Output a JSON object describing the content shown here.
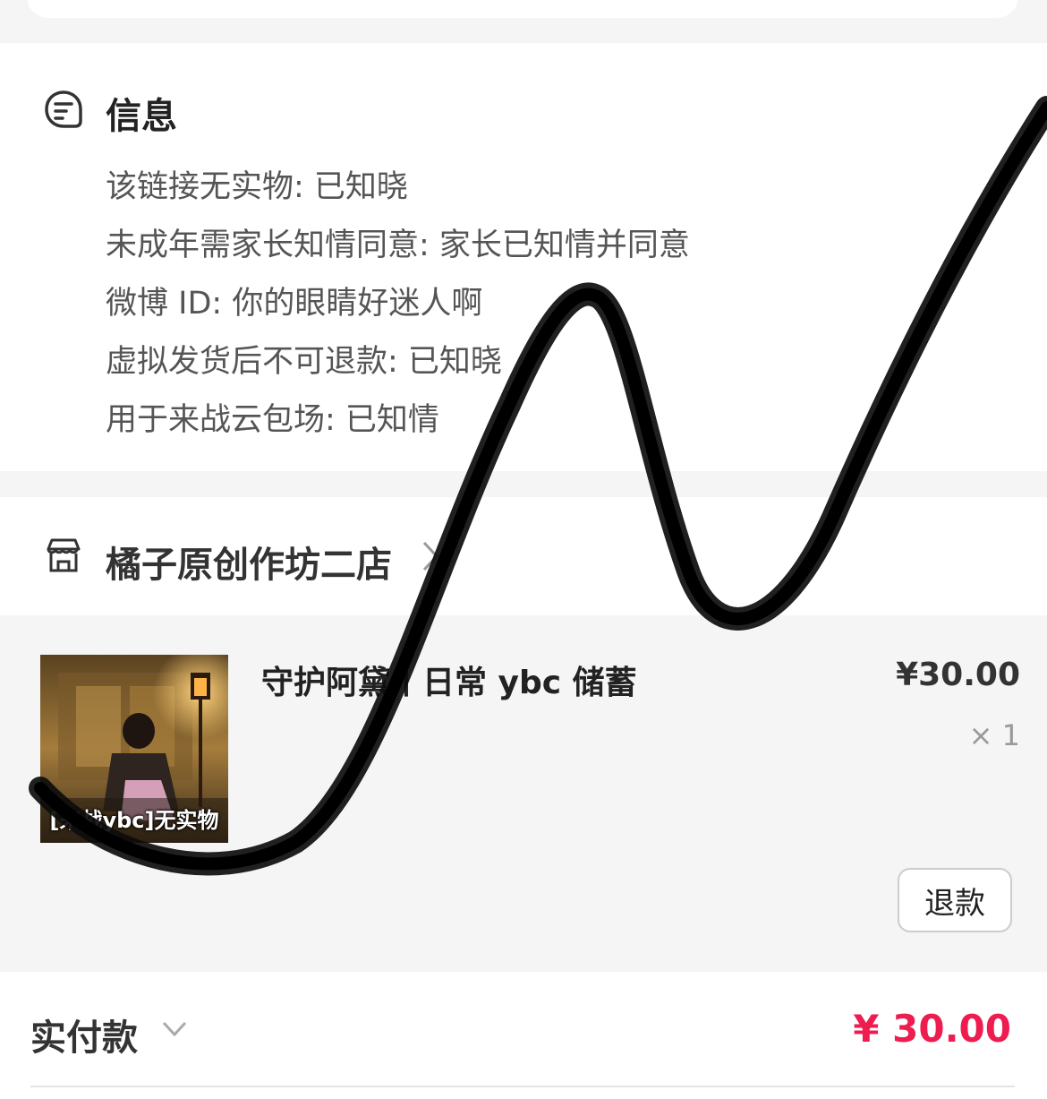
{
  "info": {
    "title": "信息",
    "lines": [
      "该链接无实物: 已知晓",
      "未成年需家长知情同意: 家长已知情并同意",
      "微博 ID: 你的眼睛好迷人啊",
      "虚拟发货后不可退款: 已知晓",
      "用于来战云包场: 已知情"
    ]
  },
  "shop": {
    "name": "橘子原创作坊二店"
  },
  "item": {
    "title": "守护阿黛丨日常 ybc 储蓄",
    "price": "¥30.00",
    "qty": "× 1",
    "thumb_caption": "[来战ybc]无实物",
    "refund_label": "退款"
  },
  "payment": {
    "label": "实付款",
    "amount": "¥ 30.00",
    "amount_color": "#ee1c4f"
  },
  "icons": {
    "info": "note-icon",
    "shop": "store-icon",
    "shop_chevron": "chevron-right-icon",
    "payment_chevron": "chevron-down-icon"
  }
}
